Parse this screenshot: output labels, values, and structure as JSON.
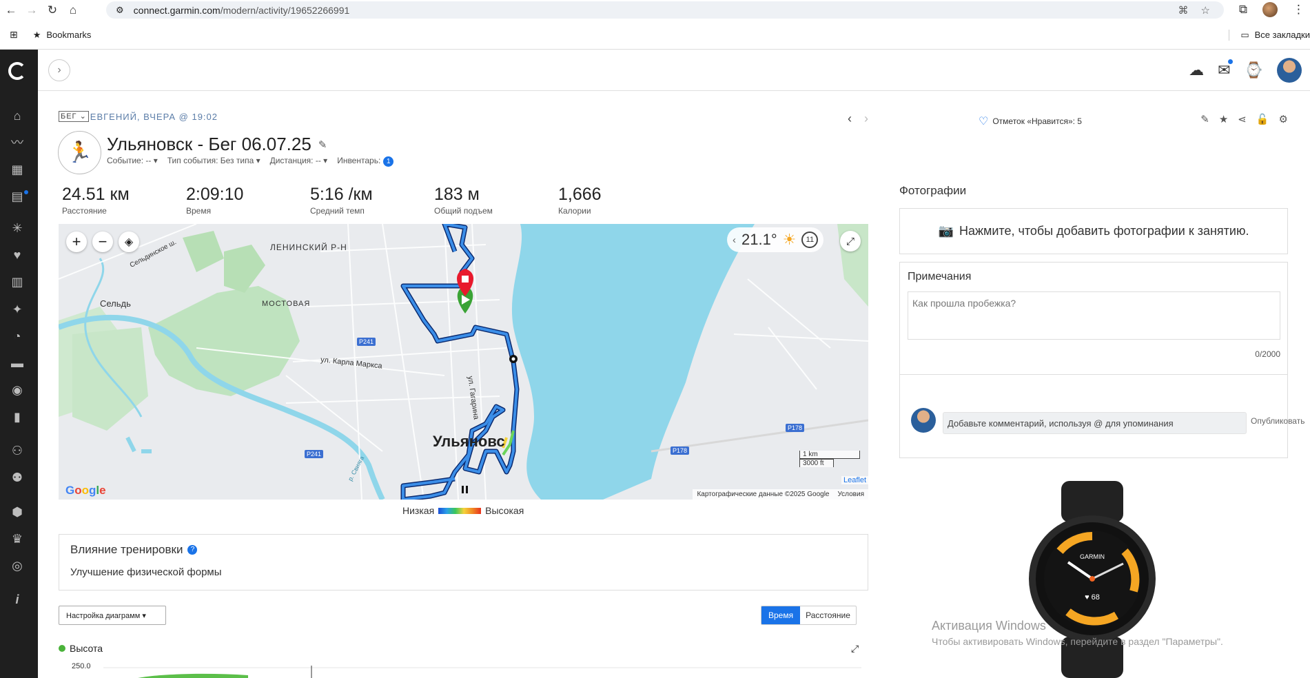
{
  "browser": {
    "url_domain": "connect.garmin.com",
    "url_path": "/modern/activity/19652266991",
    "bookmarks_label": "Bookmarks",
    "all_bookmarks_label": "Все закладки"
  },
  "activity": {
    "sport_select": "БЕГ",
    "breadcrumb": "ЕВГЕНИЙ, ВЧЕРА @ 19:02",
    "title": "Ульяновск - Бег 06.07.25",
    "event": "Событие: -- ▾",
    "event_type": "Тип события: Без типа ▾",
    "distance_meta": "Дистанция: -- ▾",
    "inventory_label": "Инвентарь:",
    "inventory_count": "1",
    "likes": "Отметок «Нравится»: 5"
  },
  "stats": [
    {
      "value": "24.51 км",
      "label": "Расстояние"
    },
    {
      "value": "2:09:10",
      "label": "Время"
    },
    {
      "value": "5:16 /км",
      "label": "Средний темп"
    },
    {
      "value": "183 м",
      "label": "Общий подъем"
    },
    {
      "value": "1,666",
      "label": "Калории"
    }
  ],
  "map": {
    "weather_temp": "21.1°",
    "wind_speed": "11",
    "labels": {
      "district": "ЛЕНИНСКИЙ Р-Н",
      "selo": "Сельдь",
      "mostovaya": "МОСТОВАЯ",
      "city": "Ульяновс",
      "karla_marksa": "ул. Карла Маркса",
      "gagarina": "ул. Гагарина",
      "seldinskoe": "Сельдинское ш.",
      "reka": "р. Свияга",
      "r241a": "P241",
      "r241b": "P241",
      "r178a": "P178",
      "r178b": "P178"
    },
    "scale_km": "1 km",
    "scale_ft": "3000 ft",
    "leaflet": "Leaflet",
    "attribution": "Картографические данные ©2025 Google",
    "terms": "Условия"
  },
  "legend": {
    "low": "Низкая",
    "high": "Высокая"
  },
  "training_effect": {
    "title": "Влияние тренировки",
    "value": "Улучшение физической формы"
  },
  "charts": {
    "settings_label": "Настройка диаграмм ▾",
    "toggle_time": "Время",
    "toggle_distance": "Расстояние",
    "elevation_label": "Высота",
    "elevation_axis_top": "250.0"
  },
  "right": {
    "photos_title": "Фотографии",
    "photos_prompt": "Нажмите, чтобы добавить фотографии к занятию.",
    "notes_title": "Примечания",
    "notes_placeholder": "Как прошла пробежка?",
    "notes_counter": "0/2000",
    "comment_placeholder": "Добавьте комментарий, используя @ для упоминания",
    "publish_label": "Опубликовать"
  },
  "watch": {
    "brand": "GARMIN",
    "heart_rate": "68"
  },
  "windows": {
    "activate_title": "Активация Windows",
    "activate_sub": "Чтобы активировать Windows, перейдите в раздел \"Параметры\"."
  },
  "colors": {
    "accent": "#1a73e8",
    "sidebar": "#1f1f1f",
    "route": "#1a73e8",
    "water": "#8fd6ea"
  }
}
